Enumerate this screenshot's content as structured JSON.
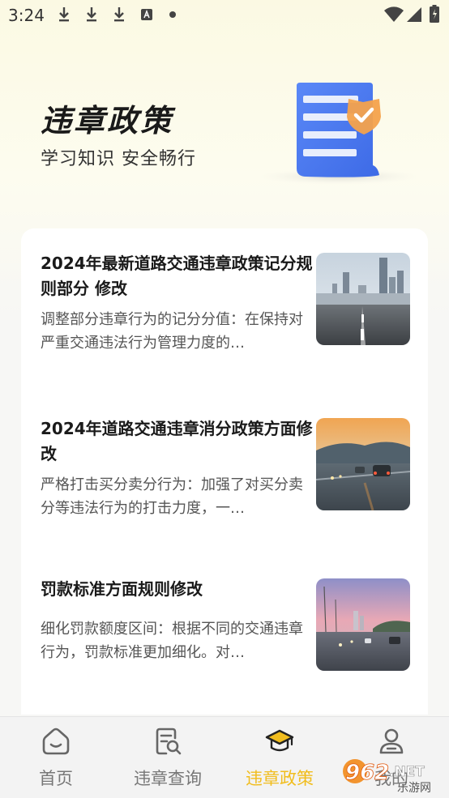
{
  "status_bar": {
    "time": "3:24",
    "icons": [
      "download-icon",
      "download-icon",
      "download-icon",
      "font-a-icon",
      "dot-icon",
      "wifi-icon",
      "signal-icon",
      "battery-icon"
    ]
  },
  "header": {
    "title": "违章政策",
    "subtitle": "学习知识 安全畅行"
  },
  "articles": [
    {
      "title": "2024年最新道路交通违章政策记分规则部分 修改",
      "summary": "调整部分违章行为的记分分值：在保持对严重交通违法行为管理力度的…",
      "thumb": "city-road-photo"
    },
    {
      "title": "2024年道路交通违章消分政策方面修改",
      "summary": "严格打击买分卖分行为：加强了对买分卖分等违法行为的打击力度，一…",
      "thumb": "highway-traffic-photo"
    },
    {
      "title": "罚款标准方面规则修改",
      "summary": "细化罚款额度区间：根据不同的交通违章行为，罚款标准更加细化。对…",
      "thumb": "dusk-highway-photo"
    }
  ],
  "nav": {
    "items": [
      {
        "label": "首页",
        "icon": "home-icon"
      },
      {
        "label": "违章查询",
        "icon": "document-search-icon"
      },
      {
        "label": "违章政策",
        "icon": "graduation-cap-icon"
      },
      {
        "label": "我的",
        "icon": "user-icon"
      }
    ],
    "active_index": 2
  },
  "watermark": {
    "brand": "962.NET",
    "sub": "乐游网"
  },
  "colors": {
    "accent": "#f1bd1e",
    "document_blue": "#4a78f0",
    "badge_orange": "#f5a04a"
  }
}
